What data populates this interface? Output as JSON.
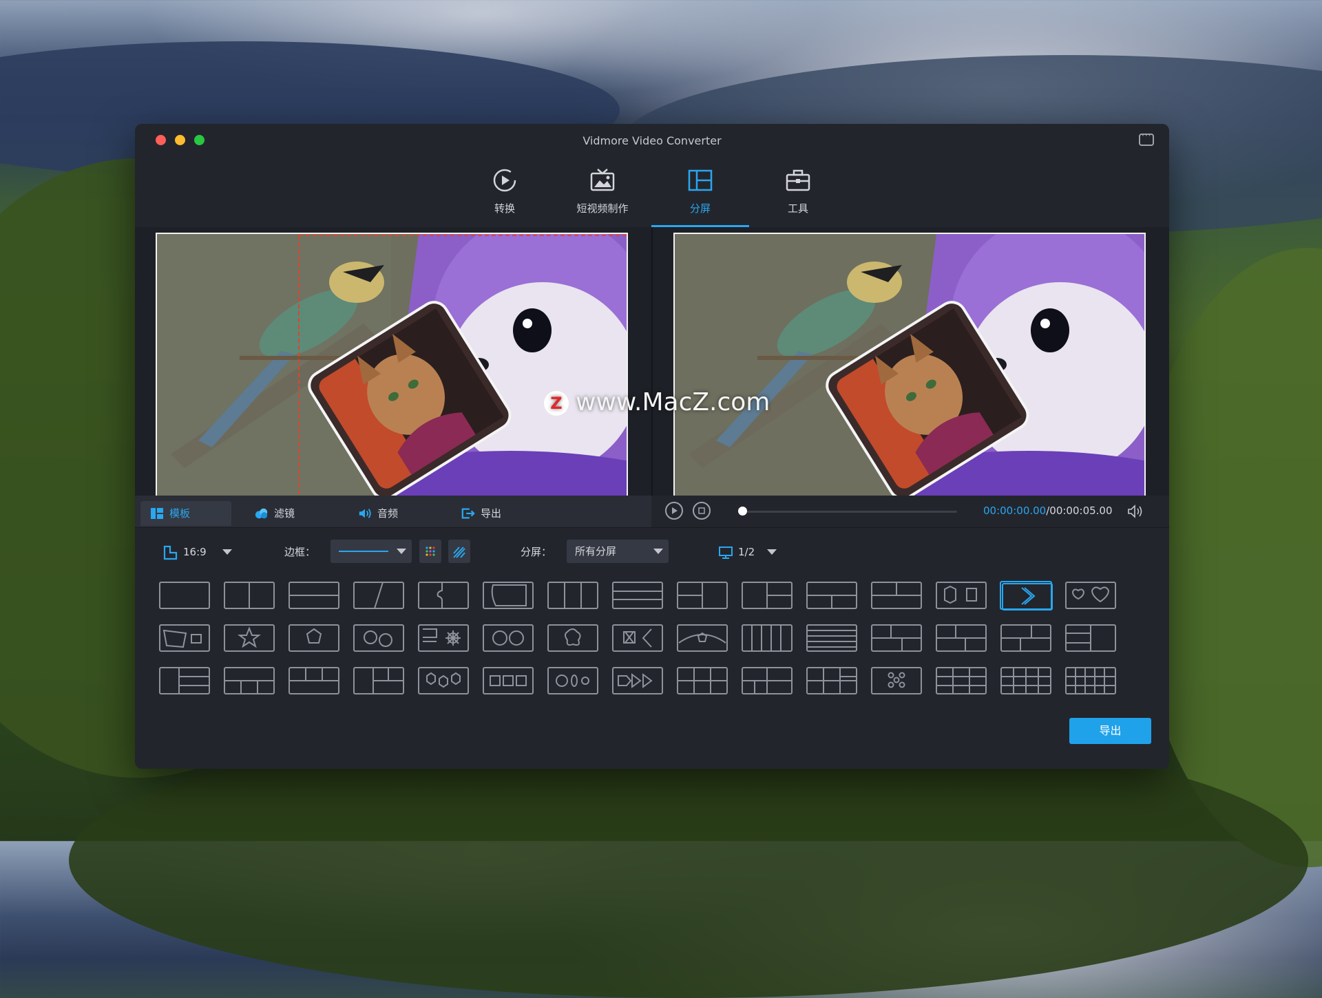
{
  "window": {
    "title": "Vidmore Video Converter"
  },
  "tabs": [
    {
      "label": "转换",
      "icon": "convert-icon"
    },
    {
      "label": "短视频制作",
      "icon": "mv-icon"
    },
    {
      "label": "分屏",
      "icon": "split-screen-icon"
    },
    {
      "label": "工具",
      "icon": "toolbox-icon"
    }
  ],
  "toolbar": {
    "template_label": "模板",
    "filter_label": "滤镜",
    "audio_label": "音频",
    "export_label": "导出"
  },
  "player": {
    "current_time": "00:00:00.00",
    "total_time": "/00:00:05.00",
    "progress": 0
  },
  "settings": {
    "aspect": "16:9",
    "border_label": "边框：",
    "split_label": "分屏：",
    "split_value": "所有分屏",
    "page": "1/2"
  },
  "templates": {
    "rows": 3,
    "cols": 15,
    "selected_index": 13
  },
  "export_button": "导出",
  "watermark": {
    "logo_letter": "Z",
    "text": "www.MacZ.com"
  },
  "colors": {
    "accent": "#29a7ef",
    "window_bg": "#23252d",
    "export": "#1fa2ea",
    "trim": "#e0442c"
  }
}
